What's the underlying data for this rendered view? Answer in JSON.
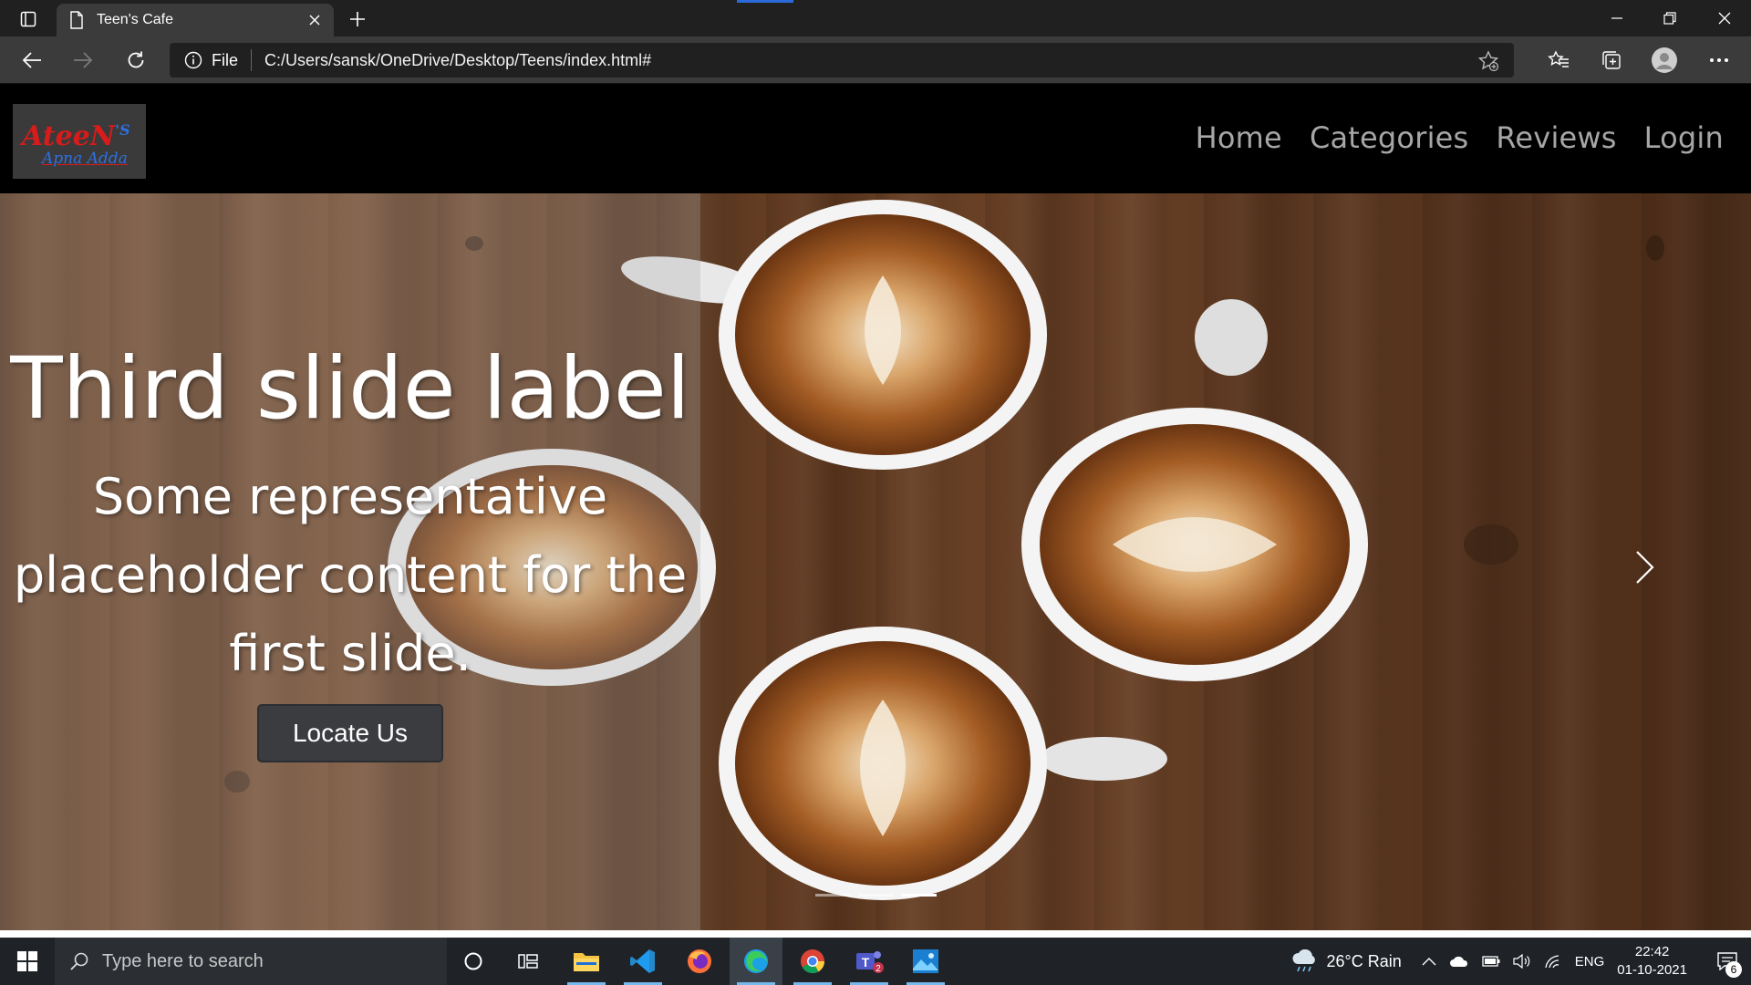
{
  "browser": {
    "tab_title": "Teen's Cafe",
    "address_scheme_label": "File",
    "url": "C:/Users/sansk/OneDrive/Desktop/Teens/index.html#"
  },
  "site": {
    "logo_line1": "AteeN",
    "logo_sup": "'S",
    "logo_line2": "Apna Adda",
    "nav": [
      "Home",
      "Categories",
      "Reviews",
      "Login"
    ]
  },
  "hero": {
    "heading": "Third slide label",
    "text": "Some representative placeholder content for the first slide.",
    "button": "Locate Us",
    "slides_total": 3,
    "active_slide": 3
  },
  "taskbar": {
    "search_placeholder": "Type here to search",
    "weather": "26°C  Rain",
    "language": "ENG",
    "time": "22:42",
    "date": "01-10-2021",
    "notification_count": "6",
    "teams_badge": "2"
  },
  "colors": {
    "accent": "#2b6ad8",
    "nav_link": "#a6a6a6",
    "button_bg": "#3a3c40"
  }
}
